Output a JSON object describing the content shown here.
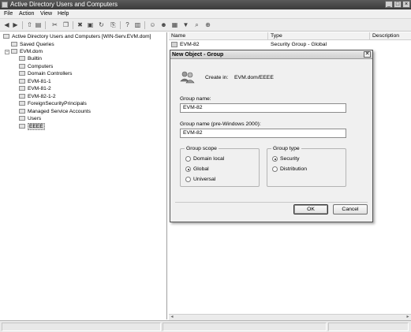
{
  "window": {
    "title": "Active Directory Users and Computers"
  },
  "menu": {
    "items": [
      "File",
      "Action",
      "View",
      "Help"
    ]
  },
  "toolbar": {
    "buttons": [
      "back-icon",
      "forward-icon",
      "up-folder-icon",
      "show-console-tree-icon",
      "cut-icon",
      "copy-icon",
      "delete-icon",
      "properties-icon",
      "refresh-icon",
      "export-list-icon",
      "help-icon",
      "show-action-pane-icon",
      "new-user-icon",
      "new-group-icon",
      "new-ou-icon",
      "filter-icon",
      "find-icon",
      "add-to-group-icon"
    ]
  },
  "tree": {
    "root": "Active Directory Users and Computers [WIN-Serv.EVM.dom]",
    "saved_queries": "Saved Queries",
    "domain": "EVM.dom",
    "children": [
      "Builtin",
      "Computers",
      "Domain Controllers",
      "EVM-81-1",
      "EVM-81-2",
      "EVM-82-1-2",
      "ForeignSecurityPrincipals",
      "Managed Service Accounts",
      "Users",
      "EEEE"
    ],
    "selected": "EEEE"
  },
  "list": {
    "columns": [
      "Name",
      "Type",
      "Description"
    ],
    "rows": [
      {
        "name": "EVM-82",
        "type": "Security Group - Global",
        "description": ""
      }
    ]
  },
  "dialog": {
    "title": "New Object - Group",
    "close_glyph": "✕",
    "create_in_label": "Create in:",
    "create_in_path": "EVM.dom/EEEE",
    "group_name_label": "Group name:",
    "group_name_value": "EVM-82",
    "pre2000_label": "Group name (pre-Windows 2000):",
    "pre2000_value": "EVM-82",
    "scope": {
      "title": "Group scope",
      "options": [
        "Domain local",
        "Global",
        "Universal"
      ],
      "selected": "Global"
    },
    "type": {
      "title": "Group type",
      "options": [
        "Security",
        "Distribution"
      ],
      "selected": "Security"
    },
    "ok_label": "OK",
    "cancel_label": "Cancel"
  }
}
